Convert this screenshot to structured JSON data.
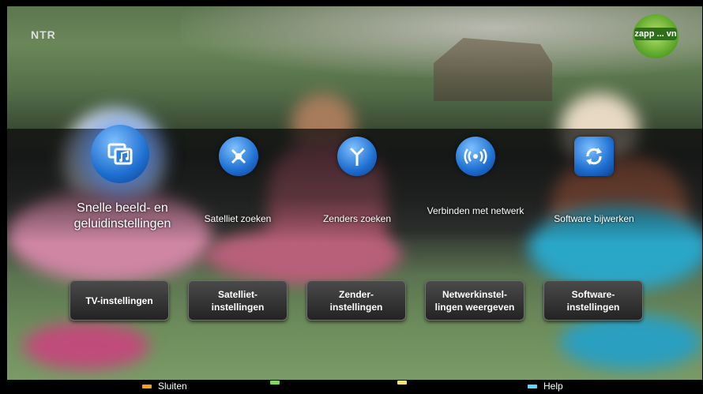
{
  "channel": "NTR",
  "logo": {
    "text": "zapp ... vn",
    "color": "#54a025"
  },
  "menu": {
    "items": [
      {
        "label": "Snelle beeld- en geluidinstellingen",
        "icon": "music-display-icon"
      },
      {
        "label": "Satelliet zoeken",
        "icon": "satellite-icon"
      },
      {
        "label": "Zenders zoeken",
        "icon": "antenna-icon"
      },
      {
        "label": "Verbinden met netwerk",
        "icon": "wireless-icon"
      },
      {
        "label": "Software bijwerken",
        "icon": "refresh-icon"
      }
    ]
  },
  "buttons": [
    {
      "label": "TV-instellingen"
    },
    {
      "label": "Satelliet-\ninstellingen"
    },
    {
      "label": "Zender-\ninstellingen"
    },
    {
      "label": "Netwerkinstel-\nlingen weergeven"
    },
    {
      "label": "Software-\ninstellingen"
    }
  ],
  "footer": {
    "hints": [
      {
        "label": "Sluiten",
        "color": "#f5a01a"
      },
      {
        "label": "",
        "color": "#7ed957"
      },
      {
        "label": "",
        "color": "#f5e27a"
      },
      {
        "label": "Help",
        "color": "#5ed6ff"
      }
    ]
  }
}
